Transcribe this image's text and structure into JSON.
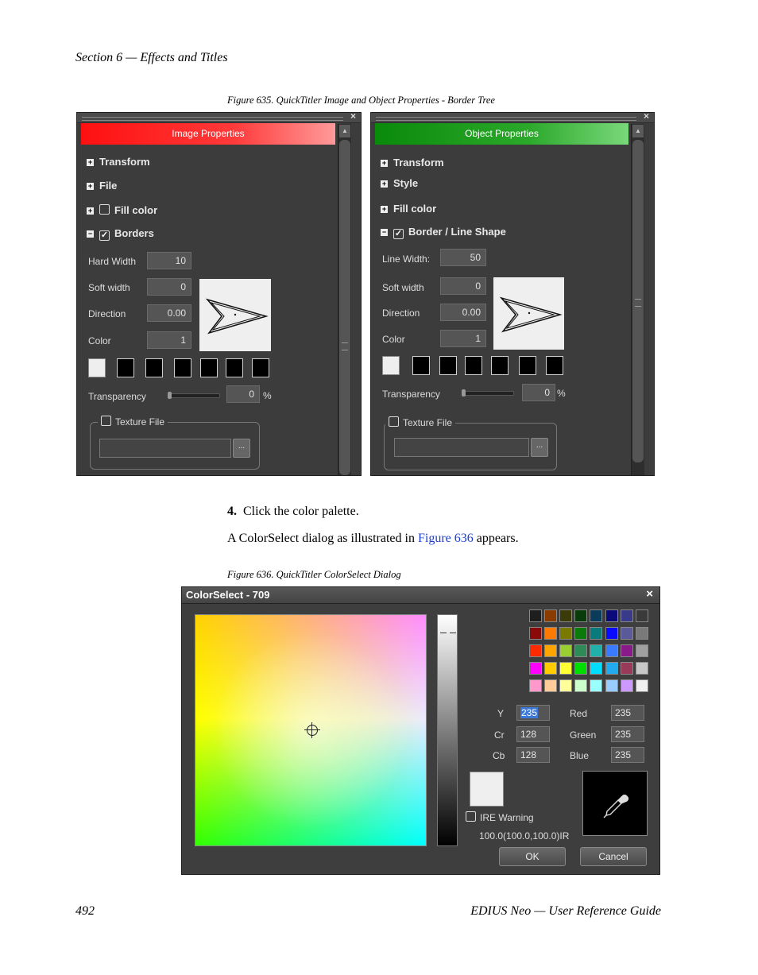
{
  "page": {
    "header": "Section 6 — Effects and Titles",
    "figure635_caption": "Figure 635.  QuickTitler Image and Object Properties - Border Tree",
    "step_number": "4.",
    "step_text": "Click the color palette.",
    "para_pre": "A ColorSelect dialog as illustrated in ",
    "para_link": "Figure 636",
    "para_post": " appears.",
    "figure636_caption": "Figure 636.  QuickTitler ColorSelect Dialog",
    "footer_page": "492",
    "footer_title": "EDIUS Neo  —  User Reference Guide"
  },
  "image_panel": {
    "title": "Image Properties",
    "title_color": "#ff1a1a",
    "close": "×",
    "tree": [
      "Transform",
      "File",
      "Fill color",
      "Borders"
    ],
    "labels": {
      "hard_width": "Hard Width",
      "soft_width": "Soft width",
      "direction": "Direction",
      "color": "Color",
      "transparency": "Transparency",
      "percent": "%",
      "texture": "Texture File"
    },
    "values": {
      "hard_width": "10",
      "soft_width": "0",
      "direction": "0.00",
      "color": "1",
      "transparency": "0"
    },
    "browse": "..."
  },
  "object_panel": {
    "title": "Object Properties",
    "title_color": "#1a9a1a",
    "close": "×",
    "tree": [
      "Transform",
      "Style",
      "Fill color",
      "Border / Line Shape"
    ],
    "labels": {
      "line_width": "Line Width:",
      "soft_width": "Soft width",
      "direction": "Direction",
      "color": "Color",
      "transparency": "Transparency",
      "percent": "%",
      "texture": "Texture File"
    },
    "values": {
      "line_width": "50",
      "soft_width": "0",
      "direction": "0.00",
      "color": "1",
      "transparency": "0"
    },
    "browse": "..."
  },
  "colorselect": {
    "title": "ColorSelect - 709",
    "close": "×",
    "palette": [
      [
        "#1e1e1e",
        "#8a3b00",
        "#3b3b0a",
        "#0a3b0a",
        "#0a3b5a",
        "#0a0a7a",
        "#3a3a8a",
        "#3a3a3a"
      ],
      [
        "#8a0a0a",
        "#ff7a00",
        "#7a7a00",
        "#0a7a0a",
        "#0a7a7a",
        "#0a0aff",
        "#5a5a9a",
        "#7a7a7a"
      ],
      [
        "#ff2a00",
        "#ffa500",
        "#9acd32",
        "#2e8b57",
        "#20b2aa",
        "#3a7aff",
        "#8a1a8a",
        "#a0a0a0"
      ],
      [
        "#ff00ff",
        "#ffcc00",
        "#ffff33",
        "#00dd00",
        "#00ddff",
        "#22aaee",
        "#9a3a5a",
        "#c8c8c8"
      ],
      [
        "#ff99cc",
        "#ffcc99",
        "#ffff99",
        "#ccffcc",
        "#99ffff",
        "#99ccff",
        "#cc99ff",
        "#efefef"
      ]
    ],
    "y_label": "Y",
    "y_value": "235",
    "cr_label": "Cr",
    "cr_value": "128",
    "cb_label": "Cb",
    "cb_value": "128",
    "red_label": "Red",
    "red_value": "235",
    "green_label": "Green",
    "green_value": "235",
    "blue_label": "Blue",
    "blue_value": "235",
    "ire_label": "IRE Warning",
    "ire_readout": "100.0(100.0,100.0)IR",
    "ok": "OK",
    "cancel": "Cancel"
  }
}
